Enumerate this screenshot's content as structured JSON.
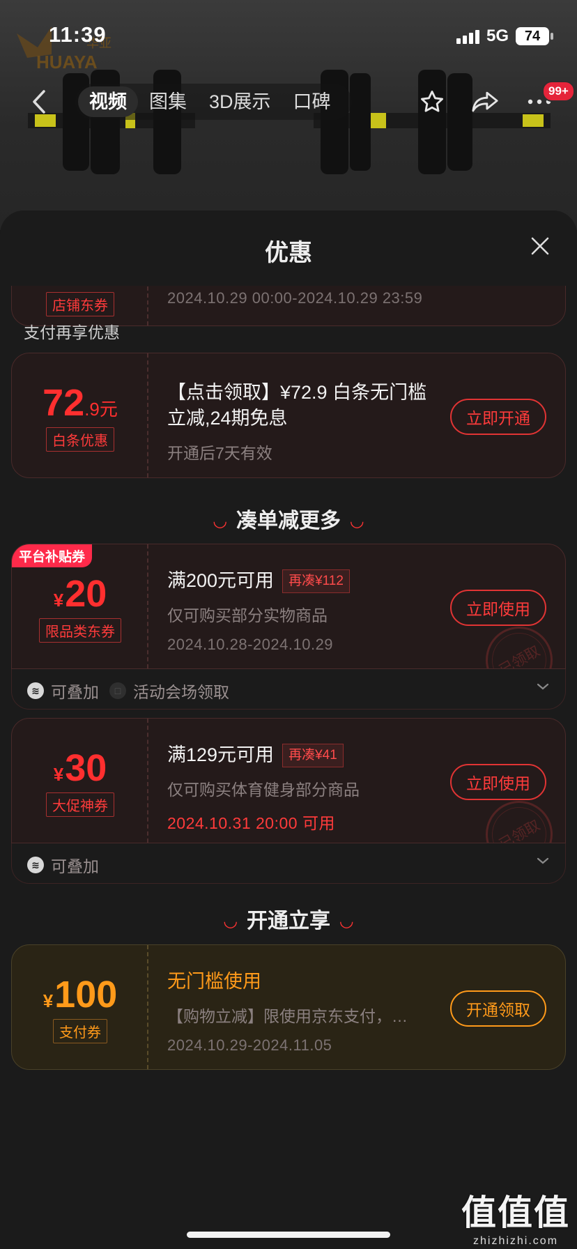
{
  "status_bar": {
    "time": "11:39",
    "network": "5G",
    "battery": "74"
  },
  "brand": {
    "logo_text": "HUAYA",
    "logo_cn": "华亚"
  },
  "nav": {
    "tabs": [
      {
        "label": "视频",
        "active": true
      },
      {
        "label": "图集",
        "active": false
      },
      {
        "label": "3D展示",
        "active": false
      },
      {
        "label": "口碑",
        "active": false
      }
    ],
    "badge": "99+"
  },
  "sheet": {
    "title": "优惠",
    "top_card": {
      "tag": "店铺东券",
      "validity": "2024.10.29 00:00-2024.10.29 23:59"
    },
    "pay_section_label": "支付再享优惠",
    "baitiao": {
      "amount_int": "72",
      "amount_dec": ".9",
      "unit": "元",
      "tag": "白条优惠",
      "title_l1": "【点击领取】¥72.9 白条无门槛",
      "title_l2": "立减,24期免息",
      "sub": "开通后7天有效",
      "button": "立即开通"
    },
    "combine_title": "凑单减更多",
    "coupons": [
      {
        "corner": "平台补贴券",
        "currency": "¥",
        "amount": "20",
        "tag": "限品类东券",
        "condition": "满200元可用",
        "gap": "再凑¥112",
        "scope": "仅可购买部分实物商品",
        "validity": "2024.10.28-2024.10.29",
        "button": "立即使用",
        "stamp": "已领取",
        "meta_stack": "可叠加",
        "meta_source": "活动会场领取"
      },
      {
        "currency": "¥",
        "amount": "30",
        "tag": "大促神券",
        "condition": "满129元可用",
        "gap": "再凑¥41",
        "scope": "仅可购买体育健身部分商品",
        "validity": "2024.10.31 20:00 可用",
        "button": "立即使用",
        "stamp": "已领取",
        "meta_stack": "可叠加"
      }
    ],
    "open_title": "开通立享",
    "pay_coupon": {
      "currency": "¥",
      "amount": "100",
      "tag": "支付券",
      "title": "无门槛使用",
      "desc": "【购物立减】限使用京东支付，…",
      "validity": "2024.10.29-2024.11.05",
      "button": "开通领取"
    }
  },
  "watermark": {
    "big": "值值值",
    "small": "zhizhizhi.com"
  },
  "colors": {
    "accent_red": "#ff2f2f",
    "accent_orange": "#ff9a1a",
    "sheet_bg": "#1b1b1b"
  }
}
